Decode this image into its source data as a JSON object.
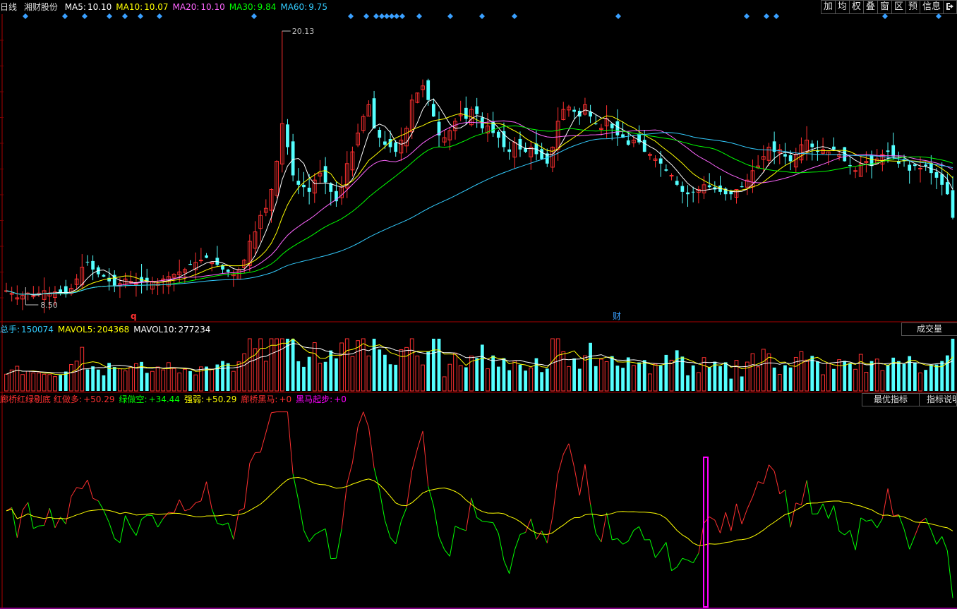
{
  "header": {
    "period_label": "日线",
    "stock_name": "湘财股份",
    "ma": [
      {
        "label": "MA5:",
        "value": "10.10",
        "color": "#ffffff"
      },
      {
        "label": "MA10:",
        "value": "10.07",
        "color": "#ffff00"
      },
      {
        "label": "MA20:",
        "value": "10.10",
        "color": "#ff66ff"
      },
      {
        "label": "MA30:",
        "value": "9.84",
        "color": "#00ff00"
      },
      {
        "label": "MA60:",
        "value": "9.75",
        "color": "#33ccff"
      }
    ]
  },
  "toolbar": {
    "buttons": [
      "加",
      "均",
      "权",
      "叠",
      "窗",
      "区",
      "预",
      "信息"
    ],
    "exit_icon": "exit-icon"
  },
  "price_panel": {
    "high_label": "20.13",
    "low_label": "8.50",
    "marker_q": "q",
    "marker_cai": "财"
  },
  "volume_panel": {
    "items": [
      {
        "label": "总手:",
        "value": "150074",
        "color": "#33ccff"
      },
      {
        "label": "MAVOL5:",
        "value": "204368",
        "color": "#ffff00"
      },
      {
        "label": "MAVOL10:",
        "value": "277234",
        "color": "#ffffff"
      }
    ],
    "button": "成交量"
  },
  "indicator_panel": {
    "title": "廊桥红绿剔底",
    "items": [
      {
        "label": "红做多:",
        "value": "+50.29",
        "color": "#ff3030"
      },
      {
        "label": "绿做空:",
        "value": "+34.44",
        "color": "#00ff00"
      },
      {
        "label": "强弱:",
        "value": "+50.29",
        "color": "#ffff00"
      },
      {
        "label": "廊桥黑马:",
        "value": "+0",
        "color": "#ff3030"
      },
      {
        "label": "黑马起步:",
        "value": "+0",
        "color": "#ff00ff"
      }
    ],
    "buttons": [
      "最优指标",
      "指标说明"
    ]
  },
  "colors": {
    "up": "#ff3030",
    "down": "#54ffff",
    "ma5": "#ffffff",
    "ma10": "#ffff00",
    "ma20": "#ff66ff",
    "ma30": "#00ff00",
    "ma60": "#33ccff",
    "diamond": "#3aa0ff",
    "grid": "#7a0000"
  },
  "chart_data": {
    "type": "candlestick",
    "price_range": [
      8.5,
      20.13
    ],
    "closes": [
      9.1,
      9.0,
      8.8,
      8.9,
      9.0,
      8.9,
      9.0,
      9.1,
      9.0,
      9.05,
      9.0,
      8.95,
      9.2,
      9.6,
      10.1,
      10.3,
      10.0,
      9.8,
      9.7,
      9.5,
      9.3,
      9.4,
      9.6,
      9.5,
      9.4,
      9.5,
      9.45,
      9.5,
      9.4,
      9.6,
      9.7,
      9.8,
      9.9,
      10.0,
      10.2,
      10.3,
      10.4,
      10.5,
      10.3,
      10.2,
      10.0,
      9.9,
      9.8,
      10.0,
      10.4,
      11.2,
      11.6,
      12.3,
      12.6,
      13.4,
      14.6,
      16.2,
      15.2,
      14.0,
      13.6,
      13.5,
      13.3,
      13.8,
      14.1,
      13.7,
      13.3,
      12.9,
      13.5,
      14.5,
      15.0,
      15.8,
      16.5,
      17.0,
      16.0,
      15.6,
      15.3,
      15.2,
      15.0,
      15.5,
      16.0,
      17.2,
      17.5,
      17.8,
      17.2,
      16.5,
      15.7,
      15.6,
      15.9,
      16.3,
      16.6,
      16.4,
      16.8,
      16.6,
      16.0,
      16.1,
      15.8,
      15.6,
      15.2,
      15.0,
      15.4,
      15.1,
      15.0,
      15.2,
      14.9,
      14.7,
      14.5,
      15.2,
      16.3,
      16.8,
      16.9,
      16.7,
      16.5,
      17.0,
      16.5,
      16.2,
      16.0,
      16.4,
      16.0,
      15.7,
      15.6,
      15.3,
      15.5,
      15.4,
      15.0,
      14.9,
      14.7,
      14.5,
      14.2,
      14.0,
      13.6,
      13.3,
      13.2,
      13.3,
      13.4,
      13.6,
      13.5,
      13.4,
      13.3,
      13.2,
      13.2,
      13.4,
      13.5,
      13.8,
      14.2,
      14.4,
      14.8,
      15.2,
      15.0,
      15.1,
      14.8,
      14.6,
      14.9,
      15.3,
      15.5,
      15.2,
      15.0,
      15.1,
      15.0,
      15.1,
      14.9,
      14.6,
      14.4,
      14.2,
      14.5,
      14.6,
      14.4,
      14.7,
      14.9,
      15.0,
      14.8,
      14.5,
      14.6,
      14.2,
      14.4,
      14.3,
      14.4,
      14.1,
      13.9,
      13.6,
      13.2,
      12.2
    ],
    "volume_range": [
      0,
      1.0
    ],
    "indicator_range": [
      0,
      100
    ]
  }
}
